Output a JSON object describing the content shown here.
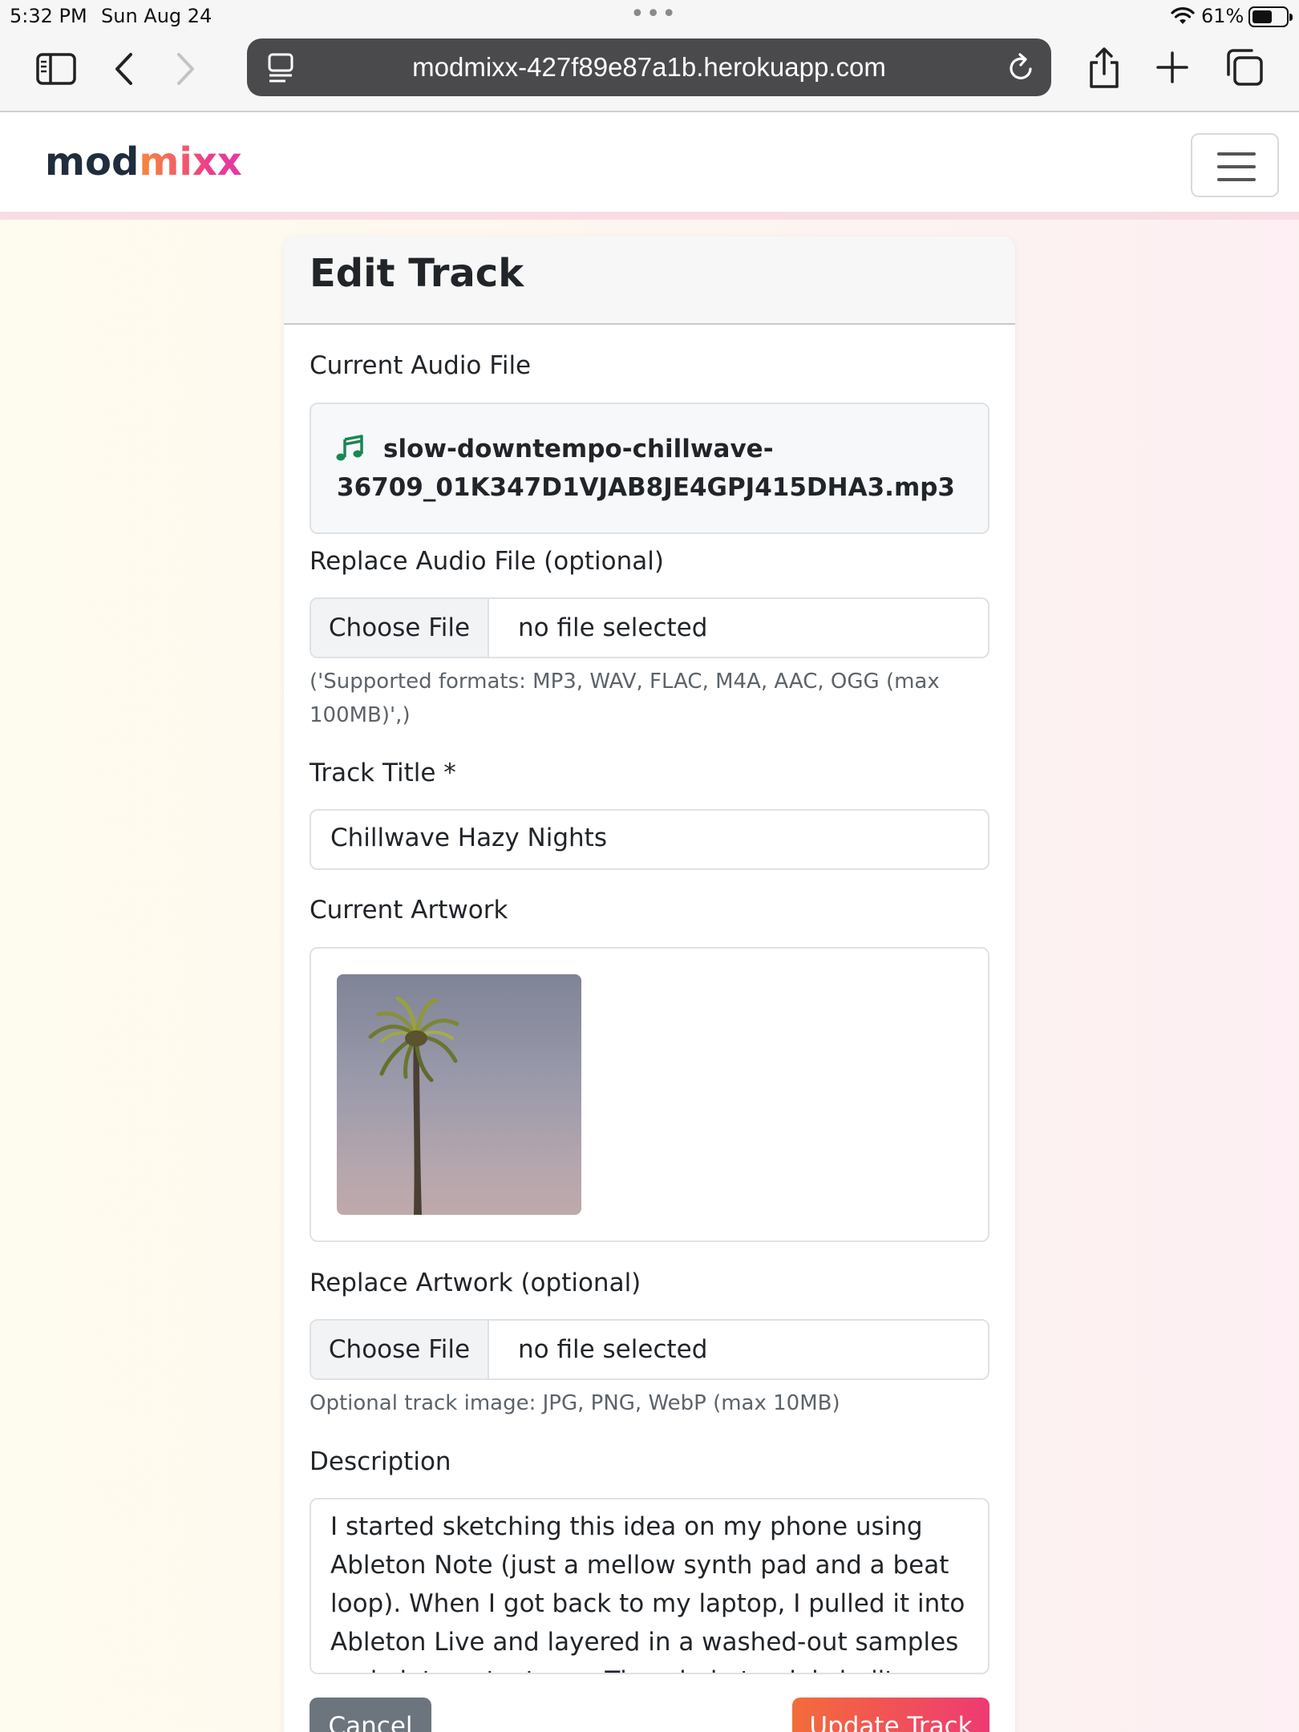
{
  "status_bar": {
    "time": "5:32 PM",
    "date": "Sun Aug 24",
    "battery_percent": "61%",
    "battery_level": 0.61
  },
  "browser": {
    "url": "modmixx-427f89e87a1b.herokuapp.com"
  },
  "navbar": {
    "brand_part1": "mod",
    "brand_part2": "mixx"
  },
  "form": {
    "title": "Edit Track",
    "current_audio_label": "Current Audio File",
    "current_audio_line1": "slow-downtempo-chillwave-",
    "current_audio_line2": "36709_01K347D1VJAB8JE4GPJ415DHA3.mp3",
    "replace_audio_label": "Replace Audio File (optional)",
    "replace_audio_button": "Choose File",
    "replace_audio_status": "no file selected",
    "replace_audio_help": "('Supported formats: MP3, WAV, FLAC, M4A, AAC, OGG (max 100MB)',)",
    "track_title_label": "Track Title *",
    "track_title_value": "Chillwave Hazy Nights",
    "current_artwork_label": "Current Artwork",
    "replace_artwork_label": "Replace Artwork (optional)",
    "replace_artwork_button": "Choose File",
    "replace_artwork_status": "no file selected",
    "replace_artwork_help": "Optional track image: JPG, PNG, WebP (max 10MB)",
    "description_label": "Description",
    "description_value": "I started sketching this idea on my phone using Ableton Note (just a mellow synth pad and a beat loop). When I got back to my laptop, I pulled it into Ableton Live and layered in a washed-out samples and vintage textures. The whole track is built around that",
    "cancel_label": "Cancel",
    "update_label": "Update Track"
  },
  "colors": {
    "brand_dark": "#1f2d3d",
    "brand_gradient_start": "#f7893a",
    "brand_gradient_end": "#e23aa8",
    "note_icon": "#198754",
    "cancel_button": "#6c757d",
    "update_button_start": "#f36c3a",
    "update_button_end": "#ee3a72"
  },
  "icons": {
    "sidebar": "sidebar-icon",
    "back": "chevron-left-icon",
    "forward": "chevron-right-icon",
    "site_info": "page-info-icon",
    "reload": "reload-icon",
    "share": "share-icon",
    "new_tab": "plus-icon",
    "tabs": "tabs-icon",
    "menu": "hamburger-icon",
    "audio": "music-note-icon"
  }
}
